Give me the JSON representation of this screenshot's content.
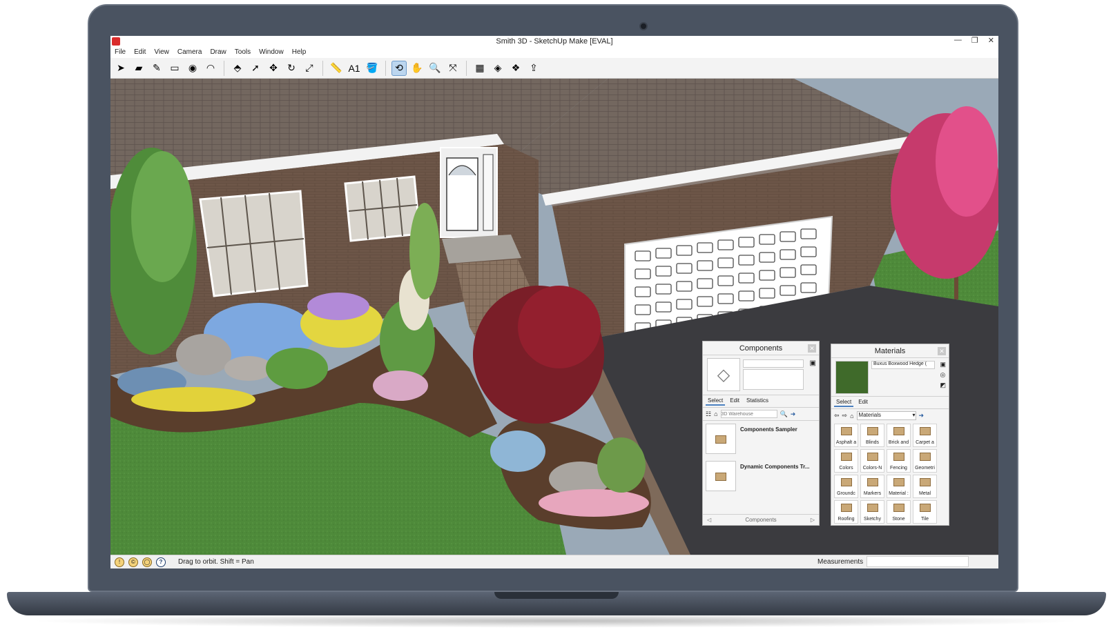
{
  "window": {
    "title": "Smith 3D - SketchUp Make [EVAL]",
    "minimize_icon": "minimize-icon",
    "maximize_icon": "restore-icon",
    "close_glyph": "✕"
  },
  "menu": [
    "File",
    "Edit",
    "View",
    "Camera",
    "Draw",
    "Tools",
    "Window",
    "Help"
  ],
  "toolbar": {
    "tools": [
      {
        "name": "select-tool",
        "glyph": "➤",
        "active": false
      },
      {
        "name": "eraser-tool",
        "glyph": "▰",
        "active": false
      },
      {
        "name": "pencil-line-tool",
        "glyph": "✎",
        "active": false
      },
      {
        "name": "rectangle-tool",
        "glyph": "▭",
        "active": false
      },
      {
        "name": "circle-tool",
        "glyph": "◉",
        "active": false
      },
      {
        "name": "arc-tool",
        "glyph": "◠",
        "active": false
      },
      {
        "name": "push-pull-tool",
        "glyph": "⬘",
        "active": false
      },
      {
        "name": "follow-me-tool",
        "glyph": "➚",
        "active": false
      },
      {
        "name": "move-tool",
        "glyph": "✥",
        "active": false
      },
      {
        "name": "rotate-tool",
        "glyph": "↻",
        "active": false
      },
      {
        "name": "scale-tool",
        "glyph": "⤢",
        "active": false
      },
      {
        "name": "tape-measure-tool",
        "glyph": "📏",
        "active": false
      },
      {
        "name": "text-tool",
        "glyph": "A1",
        "active": false
      },
      {
        "name": "paint-bucket-tool",
        "glyph": "🪣",
        "active": false
      },
      {
        "name": "orbit-tool",
        "glyph": "⟲",
        "active": true
      },
      {
        "name": "pan-tool",
        "glyph": "✋",
        "active": false
      },
      {
        "name": "zoom-tool",
        "glyph": "🔍",
        "active": false
      },
      {
        "name": "zoom-extents-tool",
        "glyph": "⤧",
        "active": false
      },
      {
        "name": "3d-warehouse-icon",
        "glyph": "▦",
        "active": false
      },
      {
        "name": "extension-warehouse-icon",
        "glyph": "◈",
        "active": false
      },
      {
        "name": "components-icon",
        "glyph": "❖",
        "active": false
      },
      {
        "name": "send-to-layout-icon",
        "glyph": "⇪",
        "active": false
      }
    ]
  },
  "status": {
    "hint": "Drag to orbit.  Shift = Pan",
    "measurements_label": "Measurements",
    "help_glyph": "?"
  },
  "components_panel": {
    "title": "Components",
    "close_glyph": "✕",
    "tabs": [
      "Select",
      "Edit",
      "Statistics"
    ],
    "selected_tab": "Select",
    "search_placeholder": "3D Warehouse",
    "items": [
      "Components Sampler",
      "Dynamic Components Tr..."
    ],
    "footer": "Components"
  },
  "materials_panel": {
    "title": "Materials",
    "close_glyph": "✕",
    "current_material": "Buxus Boxwood Hedge (",
    "tabs": [
      "Select",
      "Edit"
    ],
    "selected_tab": "Select",
    "collection": "Materials",
    "swatches": [
      "Asphalt a",
      "Blinds",
      "Brick and",
      "Carpet a",
      "Colors",
      "Colors-N",
      "Fencing",
      "Geometri",
      "Groundc",
      "Markers",
      "Material :",
      "Metal",
      "Roofing",
      "Sketchy",
      "Stone",
      "Tile"
    ]
  },
  "colors": {
    "laptop_frame": "#4a5361",
    "roof": "#6e625a",
    "brick": "#6a5446",
    "lawn": "#4f8a3a",
    "driveway": "#3a3a3e",
    "accent_blue": "#4a80c0"
  }
}
